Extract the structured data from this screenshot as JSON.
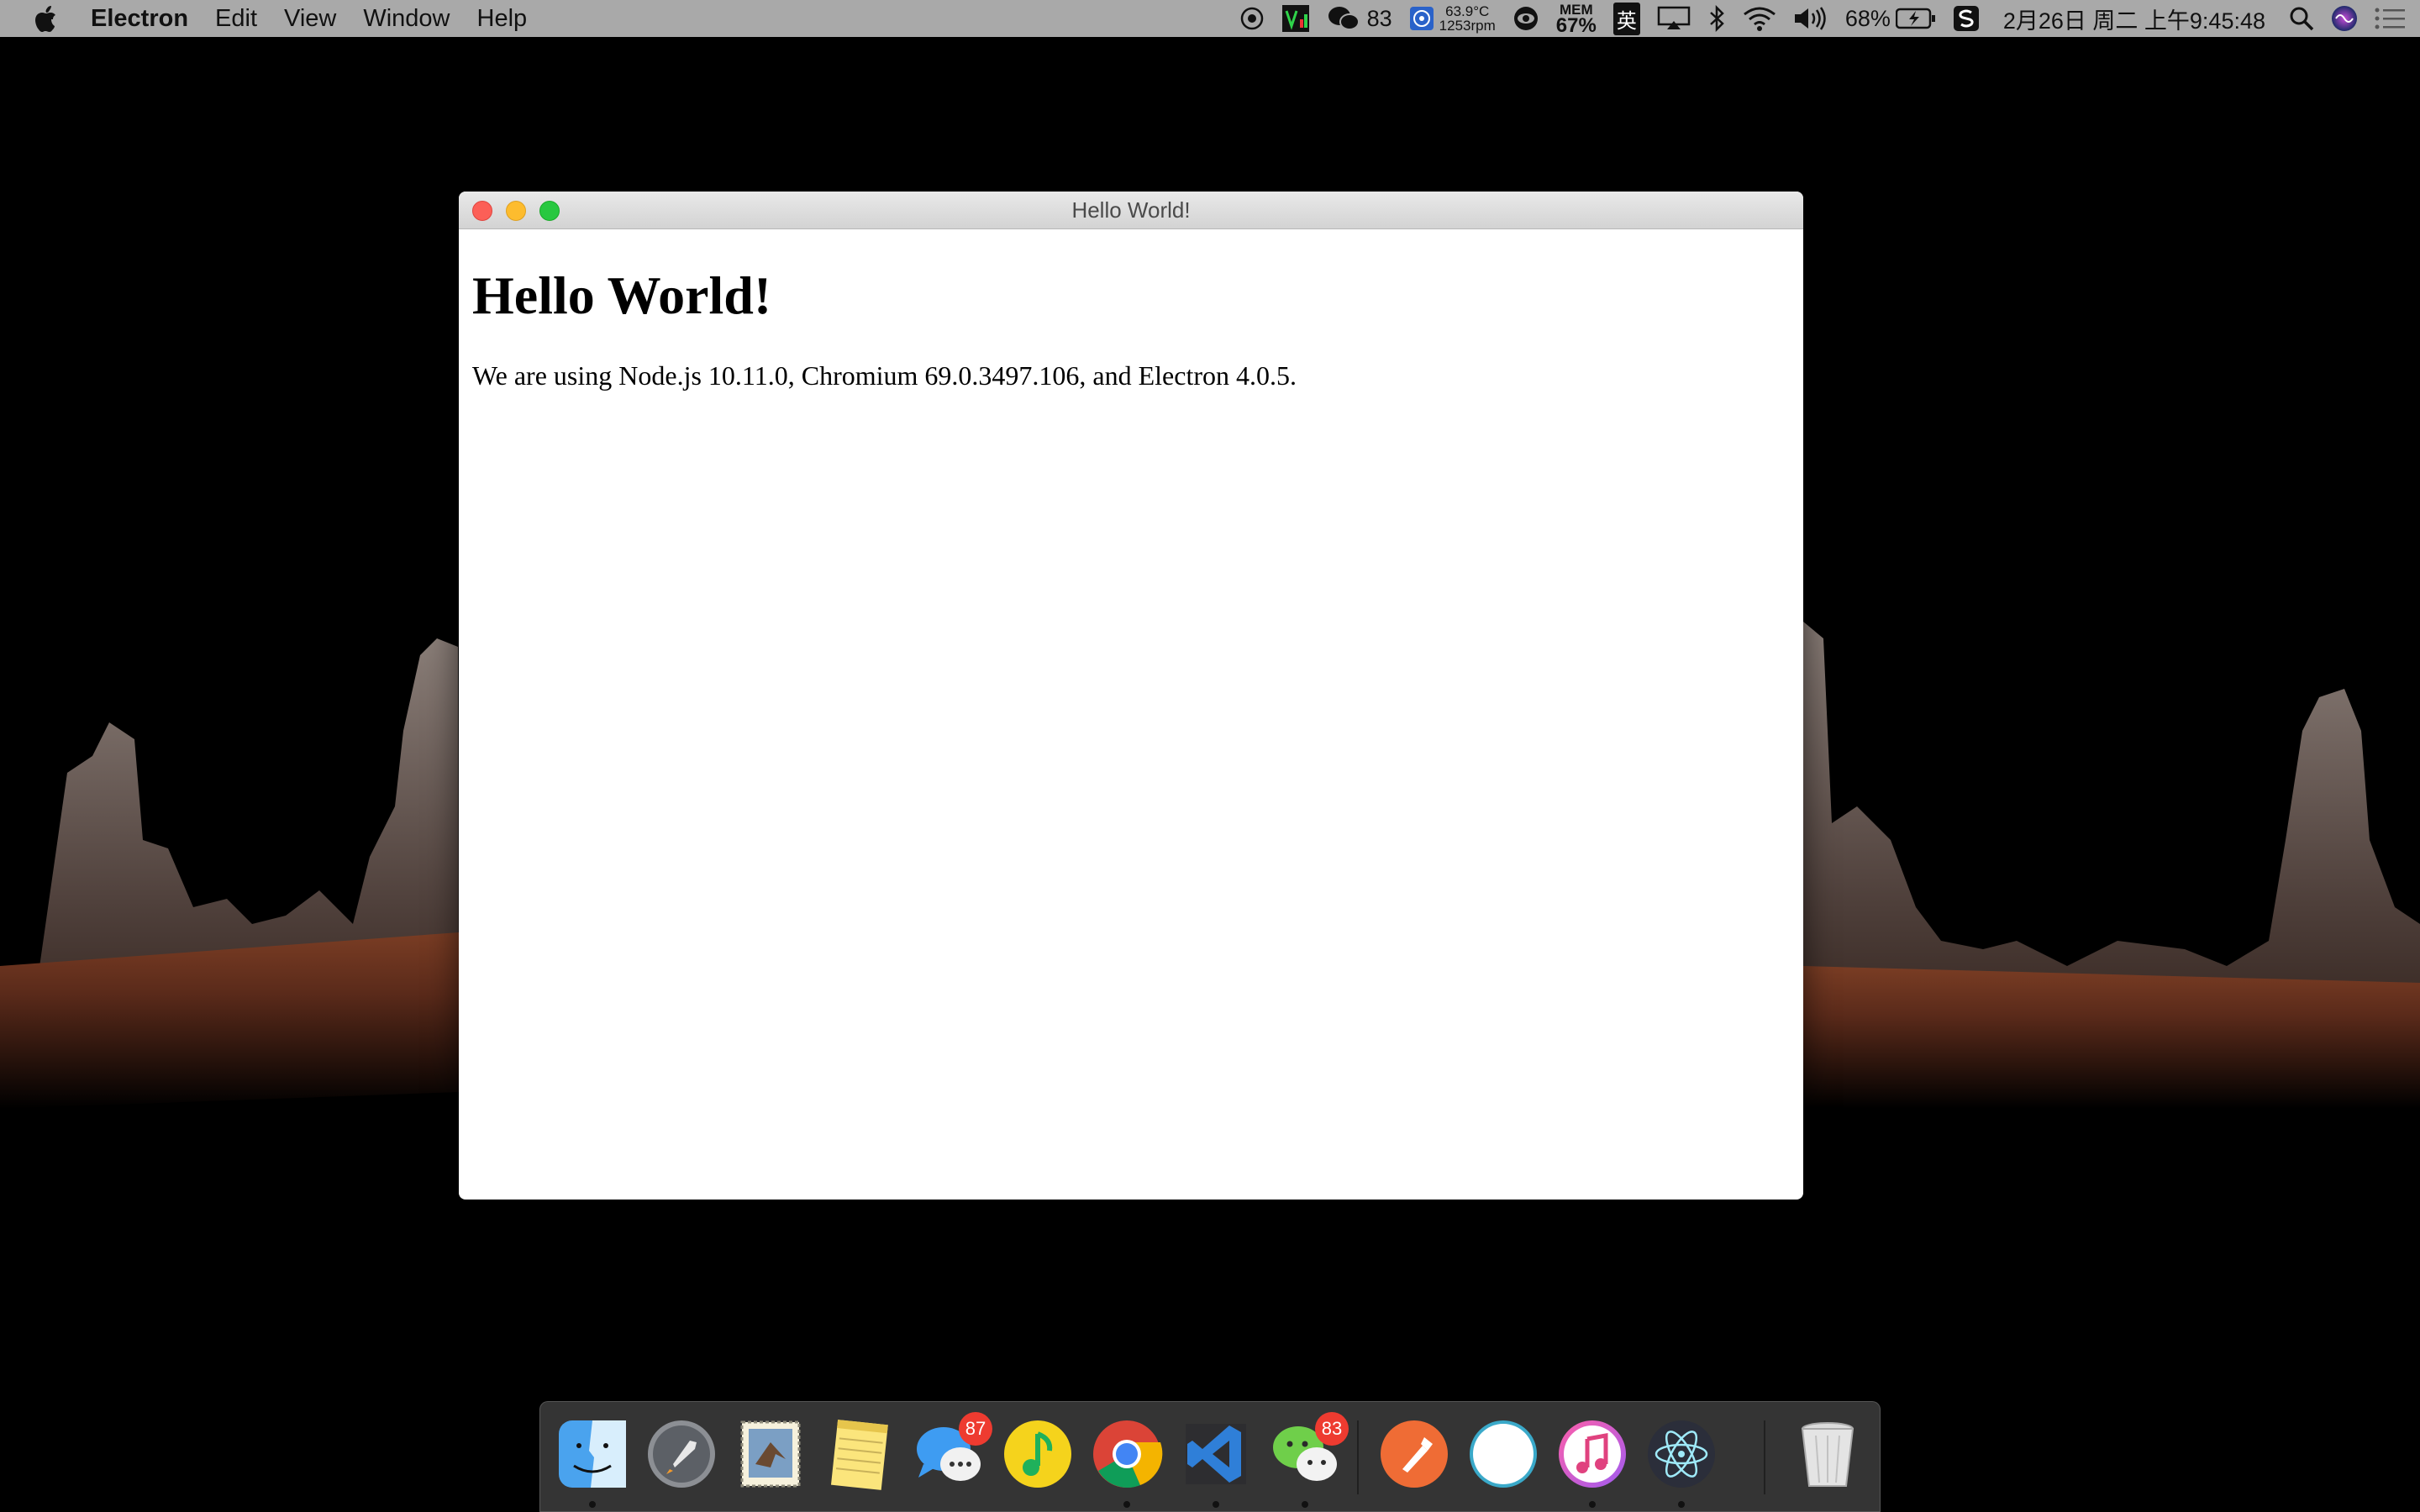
{
  "menubar": {
    "app_name": "Electron",
    "menus": [
      "Edit",
      "View",
      "Window",
      "Help"
    ],
    "status": {
      "wechat_count": "83",
      "cpu_temp": "63.9°C",
      "fan_speed": "1253rpm",
      "mem_label": "MEM",
      "mem_value": "67%",
      "input_method": "英",
      "battery": "68%",
      "datetime": "2月26日 周二 上午9:45:48"
    }
  },
  "window": {
    "title": "Hello World!",
    "heading": "Hello World!",
    "body_text": "We are using Node.js 10.11.0, Chromium 69.0.3497.106, and Electron 4.0.5."
  },
  "dock": {
    "items": [
      {
        "name": "finder",
        "icon": "finder-icon",
        "running": true
      },
      {
        "name": "launchpad",
        "icon": "launchpad-icon",
        "running": false
      },
      {
        "name": "mail",
        "icon": "mail-icon",
        "running": false
      },
      {
        "name": "notes",
        "icon": "notes-icon",
        "running": false
      },
      {
        "name": "messages",
        "icon": "messages-icon",
        "badge": "87",
        "running": false
      },
      {
        "name": "qq-music",
        "icon": "music-note-icon",
        "running": false
      },
      {
        "name": "chrome",
        "icon": "chrome-icon",
        "running": true
      },
      {
        "name": "vscode",
        "icon": "vscode-icon",
        "running": true
      },
      {
        "name": "wechat",
        "icon": "wechat-icon",
        "badge": "83",
        "running": true
      },
      {
        "name": "postman",
        "icon": "postman-icon",
        "running": false
      },
      {
        "name": "generic-app",
        "icon": "circle-app-icon",
        "running": false
      },
      {
        "name": "itunes",
        "icon": "itunes-icon",
        "running": true
      },
      {
        "name": "electron",
        "icon": "electron-icon",
        "running": true
      },
      {
        "name": "trash",
        "icon": "trash-icon",
        "running": false
      }
    ]
  }
}
